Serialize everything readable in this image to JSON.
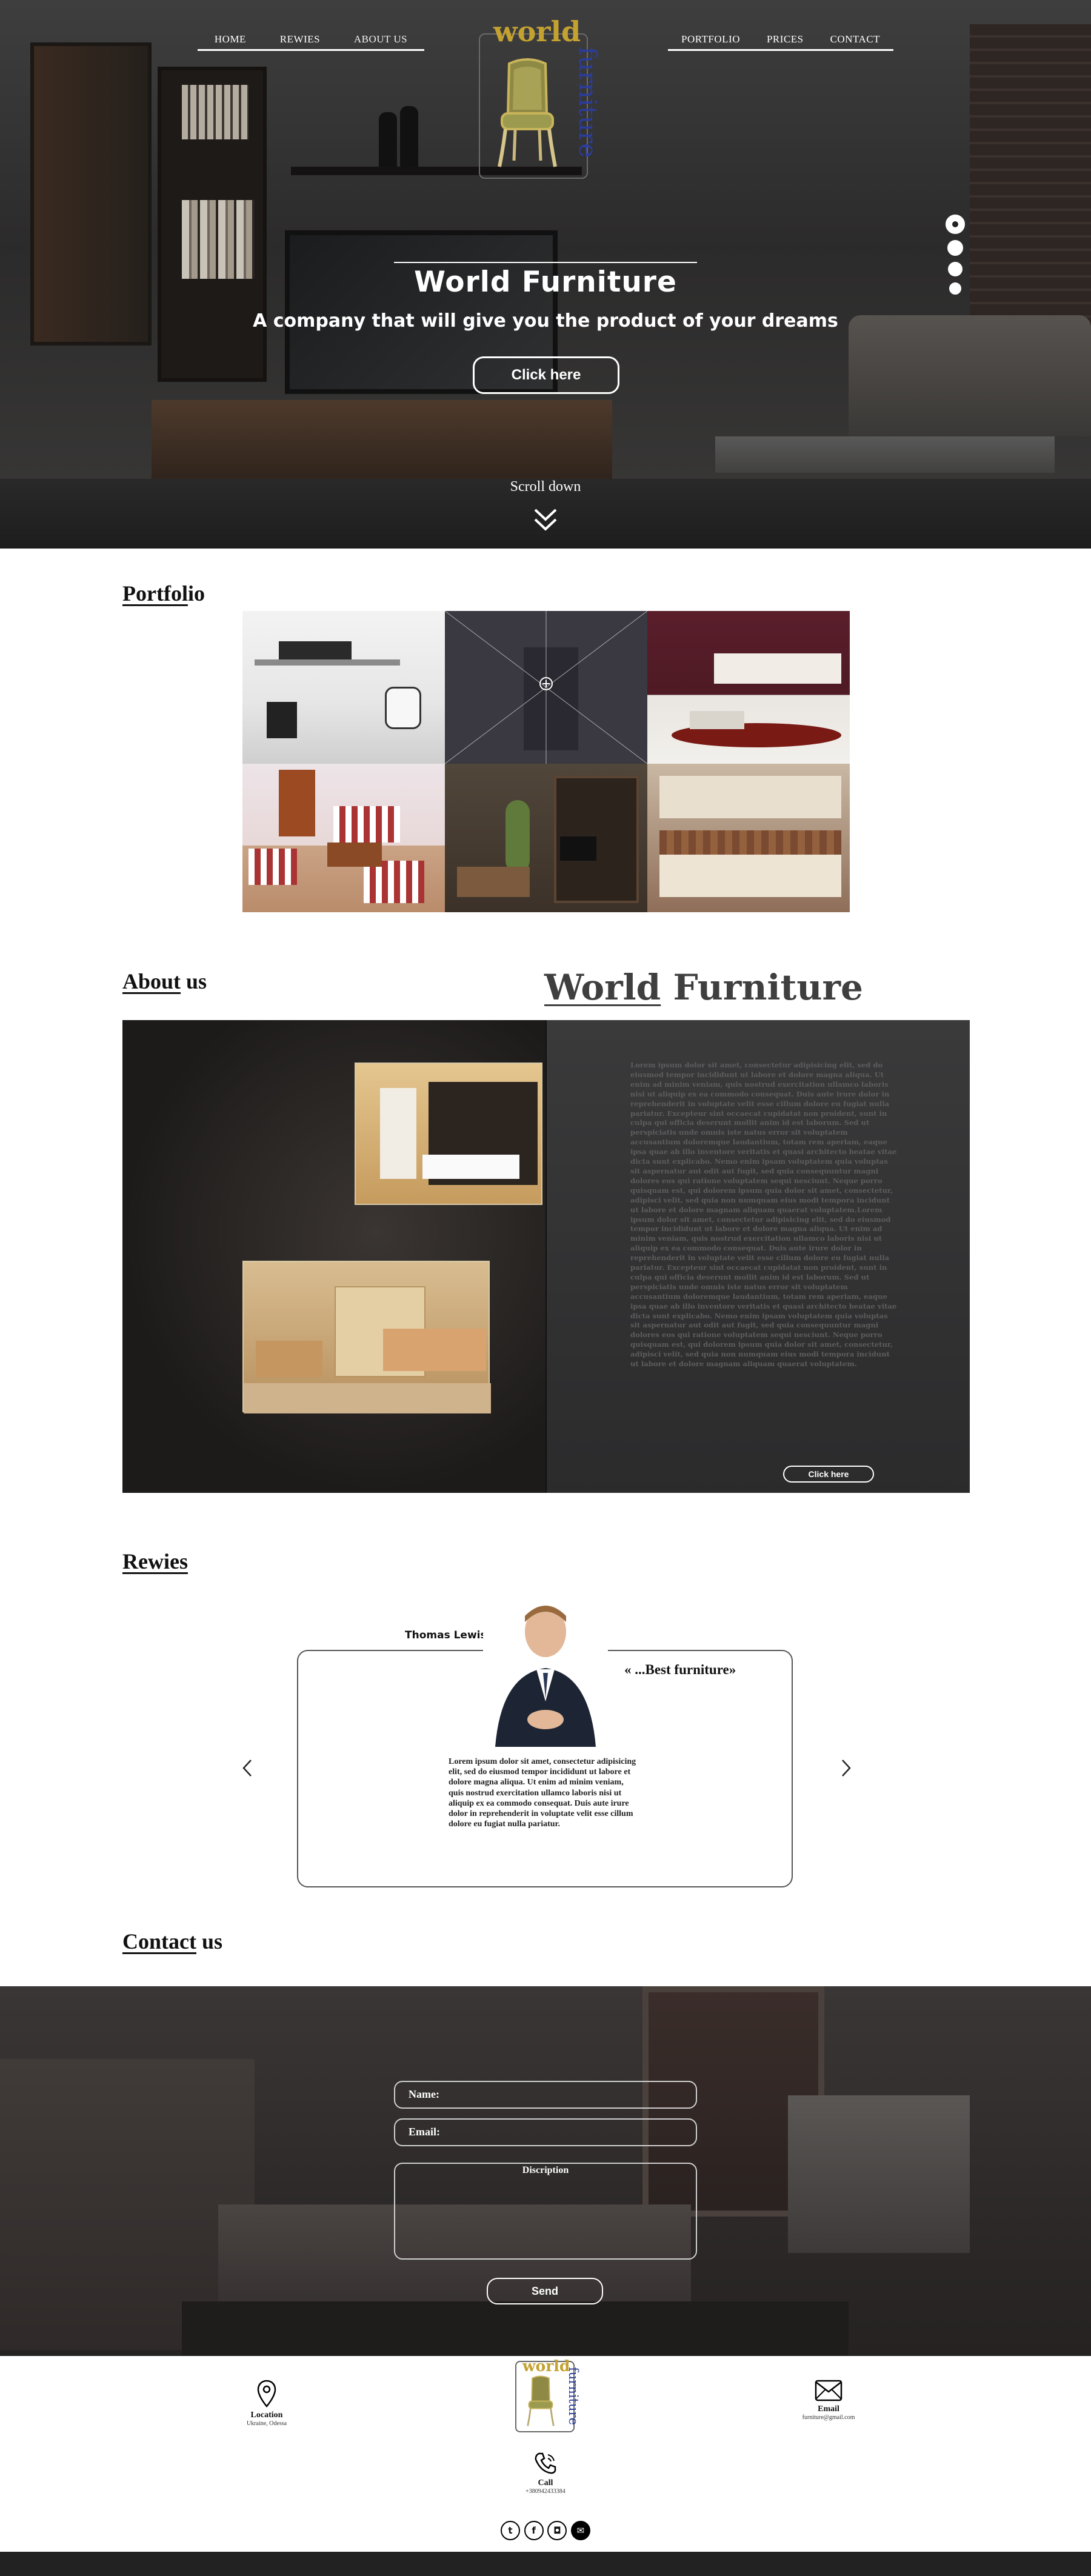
{
  "nav": {
    "left": [
      "HOME",
      "REWIES",
      "ABOUT US"
    ],
    "right": [
      "PORTFOLIO",
      "PRICES",
      "CONTACT"
    ]
  },
  "logo": {
    "word1": "world",
    "word2": "furniture"
  },
  "hero": {
    "title": "World Furniture",
    "subtitle": "A company that will give you the product of your dreams",
    "button": "Click here",
    "scroll": "Scroll down",
    "slider_active": 1,
    "slider_count": 4
  },
  "portfolio": {
    "heading_ul": "Portfol",
    "heading_rest": "io"
  },
  "about": {
    "heading_ul": "About",
    "heading_rest": " us",
    "title_ul": "World",
    "title_rest": " Furniture",
    "text": "Lorem ipsum dolor sit amet, consectetur adipisicing elit, sed do eiusmod tempor incididunt ut labore et dolore magna aliqua. Ut enim ad minim veniam, quis nostrud exercitation ullamco laboris nisi ut aliquip ex ea commodo consequat. Duis aute irure dolor in reprehenderit in voluptate velit esse cillum dolore eu fugiat nulla pariatur. Excepteur sint occaecat cupidatat non proident, sunt in culpa qui officia deserunt mollit anim id est laborum. Sed ut perspiciatis unde omnis iste natus error sit voluptatem accusantium doloremque laudantium, totam rem aperiam, eaque ipsa quae ab illo inventore veritatis et quasi architecto beatae vitae dicta sunt explicabo. Nemo enim ipsam voluptatem quia voluptas sit aspernatur aut odit aut fugit, sed quia consequuntur magni dolores eos qui ratione voluptatem sequi nesciunt. Neque porro quisquam est, qui dolorem ipsum quia dolor sit amet, consectetur, adipisci velit, sed quia non numquam eius modi tempora incidunt ut labore et dolore magnam aliquam quaerat voluptatem.Lorem ipsum dolor sit amet, consectetur adipisicing elit, sed do eiusmod tempor incididunt ut labore et dolore magna aliqua. Ut enim ad minim veniam, quis nostrud exercitation ullamco laboris nisi ut aliquip ex ea commodo consequat. Duis aute irure dolor in reprehenderit in voluptate velit esse cillum dolore eu fugiat nulla pariatur. Excepteur sint occaecat cupidatat non proident, sunt in culpa qui officia deserunt mollit anim id est laborum. Sed ut perspiciatis unde omnis iste natus error sit voluptatem accusantium doloremque laudantium, totam rem aperiam, eaque ipsa quae ab illo inventore veritatis et quasi architecto beatae vitae dicta sunt explicabo. Nemo enim ipsam voluptatem quia voluptas sit aspernatur aut odit aut fugit, sed quia consequuntur magni dolores eos qui ratione voluptatem sequi nesciunt. Neque porro quisquam est, qui dolorem ipsum quia dolor sit amet, consectetur, adipisci velit, sed quia non numquam eius modi tempora incidunt ut labore et dolore magnam aliquam quaerat voluptatem.",
    "button": "Click here"
  },
  "reviews": {
    "heading": "Rewies",
    "name": "Thomas Lewis",
    "quote": "« ...Best furniture»",
    "text": "Lorem ipsum dolor sit amet, consectetur adipisicing elit, sed do eiusmod tempor incididunt ut labore et dolore magna aliqua. Ut enim ad minim veniam, quis nostrud exercitation ullamco laboris nisi ut aliquip ex ea commodo consequat. Duis aute irure dolor in reprehenderit in voluptate velit esse cillum dolore eu fugiat nulla pariatur."
  },
  "contact": {
    "heading_ul": "Contact",
    "heading_rest": " us",
    "name_label": "Name:",
    "email_label": "Email:",
    "description_label": "Discription",
    "send": "Send"
  },
  "footer": {
    "location_title": "Location",
    "location_sub": "Ukraine, Odessa",
    "email_title": "Email",
    "email_sub": "furniture@gmail.com",
    "call_title": "Call",
    "call_sub": "+380942433384"
  },
  "colors": {
    "logo_gold": "#c4a230",
    "logo_blue": "#2a3d9c",
    "footer_bar": "#222222"
  }
}
